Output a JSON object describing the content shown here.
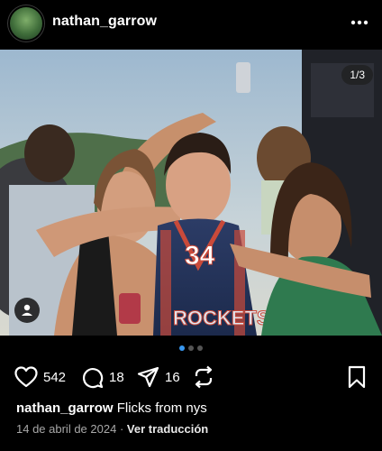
{
  "post": {
    "username": "nathan_garrow",
    "image_counter": "1/3",
    "jersey_text": "ROCKETS",
    "jersey_number": "34"
  },
  "actions": {
    "likes": "542",
    "comments": "18",
    "shares": "16"
  },
  "caption": {
    "username": "nathan_garrow",
    "text": "Flicks from nys"
  },
  "meta": {
    "date": "14 de abril de 2024",
    "separator": "·",
    "translate": "Ver traducción"
  },
  "icons": [
    "avatar",
    "more-icon",
    "tag-people-icon",
    "heart-icon",
    "comment-icon",
    "share-icon",
    "repost-icon",
    "bookmark-icon"
  ],
  "colors": {
    "background": "#000000",
    "active_dot": "#3897f0",
    "secondary_text": "#a8a8a8"
  }
}
